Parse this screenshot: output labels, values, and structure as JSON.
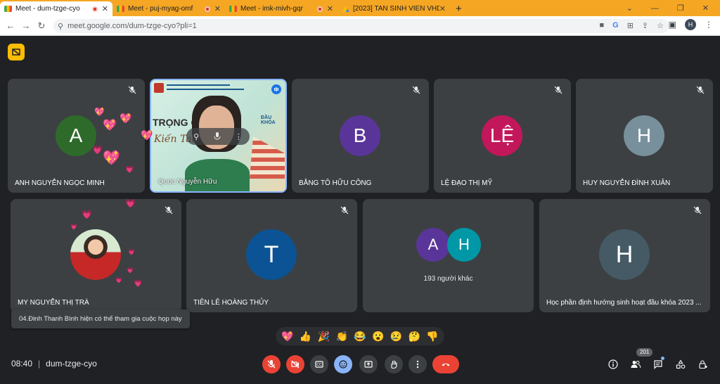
{
  "browser": {
    "tabs": [
      {
        "title": "Meet - dum-tzge-cyo",
        "recording": true
      },
      {
        "title": "Meet - puj-myag-omf",
        "recording": true
      },
      {
        "title": "Meet - imk-mivh-gqr",
        "recording": true
      },
      {
        "title": "[2023] TAN SINH VIEN VHDH LTC",
        "recording": false
      }
    ],
    "url": "meet.google.com/dum-tzge-cyo?pli=1",
    "profile_initial": "H"
  },
  "participants": [
    {
      "name": "ANH NGUYỄN NGỌC MINH",
      "initial": "A",
      "color": "#2e6b2a"
    },
    {
      "name": "Quoc Nguyễn Hữu",
      "video": true,
      "slide_text_1": "TRỌNG QU",
      "slide_text_2": "Kiến Tao T",
      "slide_badge": "ĐẦU KHÓA"
    },
    {
      "name": "BẰNG TÔ HỮU CÔNG",
      "initial": "B",
      "color": "#5a3599"
    },
    {
      "name": "LỆ ĐẠO THỊ MỸ",
      "initial": "LỆ",
      "color": "#c2185b"
    },
    {
      "name": "HUY NGUYỄN ĐÌNH XUÂN",
      "initial": "H",
      "color": "#78909c"
    },
    {
      "name": "MY NGUYỄN THỊ TRÀ",
      "photo": true
    },
    {
      "name": "TIÊN LÊ HOÀNG THỦY",
      "initial": "T",
      "color": "#0b5394"
    },
    {
      "name": "193 người khác",
      "initial": "A",
      "initial2": "H",
      "color": "#5a3599",
      "color2": "#0097a7"
    },
    {
      "name": "Học phần định hướng sinh hoạt đầu khóa 2023 ...",
      "initial": "H",
      "color": "#455a64"
    }
  ],
  "toast": "04.Đinh Thanh Bình hiện có thể tham gia cuộc họp này",
  "reactions": [
    "💖",
    "👍",
    "🎉",
    "👏",
    "😂",
    "😮",
    "😢",
    "🤔",
    "👎"
  ],
  "meeting": {
    "time": "08:40",
    "separator": "|",
    "code": "dum-tzge-cyo"
  },
  "people_count": "201",
  "colors": {
    "end_call": "#ea4335",
    "muted": "#ea4335",
    "emoji_active": "#8ab4f8"
  }
}
